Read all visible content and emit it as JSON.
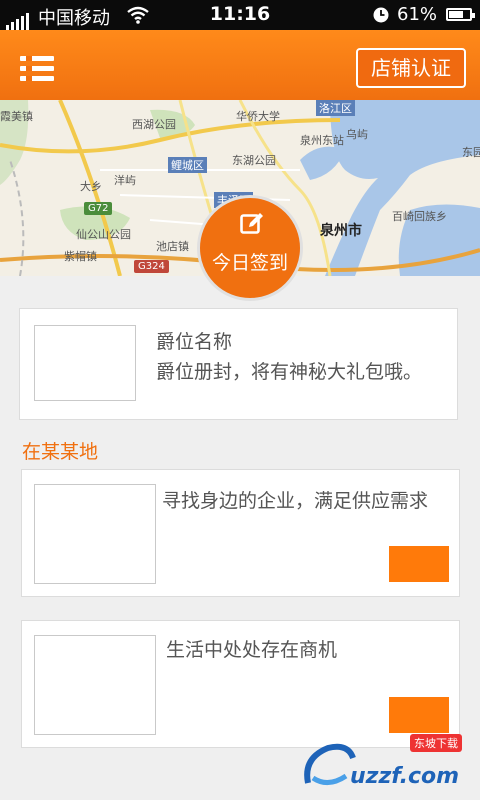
{
  "status_bar": {
    "carrier": "中国移动",
    "time": "11:16",
    "battery_pct": "61%",
    "icons": [
      "signal-icon",
      "wifi-icon",
      "alarm-clock-icon",
      "battery-icon"
    ]
  },
  "header": {
    "menu_icon": "menu-icon",
    "cert_button": "店铺认证"
  },
  "map": {
    "labels": [
      "霞美镇",
      "泉州市",
      "鲤城区",
      "丰泽区",
      "洛江区",
      "华侨大学",
      "西湖公园",
      "东湖公园",
      "泉州东站",
      "乌屿",
      "洋屿",
      "大乡",
      "仙公山公园",
      "池店镇",
      "紫帽镇",
      "百崎回族乡",
      "东园"
    ],
    "roads": [
      "G72",
      "G324"
    ]
  },
  "checkin": {
    "icon": "edit-icon",
    "label": "今日签到"
  },
  "rank_card": {
    "title": "爵位名称",
    "desc": "爵位册封，将有神秘大礼包哦。"
  },
  "section_title": "在某某地",
  "biz_cards": [
    {
      "text": "寻找身边的企业，满足供应需求"
    },
    {
      "text": "生活中处处存在商机"
    }
  ],
  "watermark": {
    "text": "uzzf.com",
    "badge": "东坡下载"
  },
  "colors": {
    "accent": "#f07010",
    "background": "#efefef",
    "status_bar": "#0b0b0b"
  }
}
